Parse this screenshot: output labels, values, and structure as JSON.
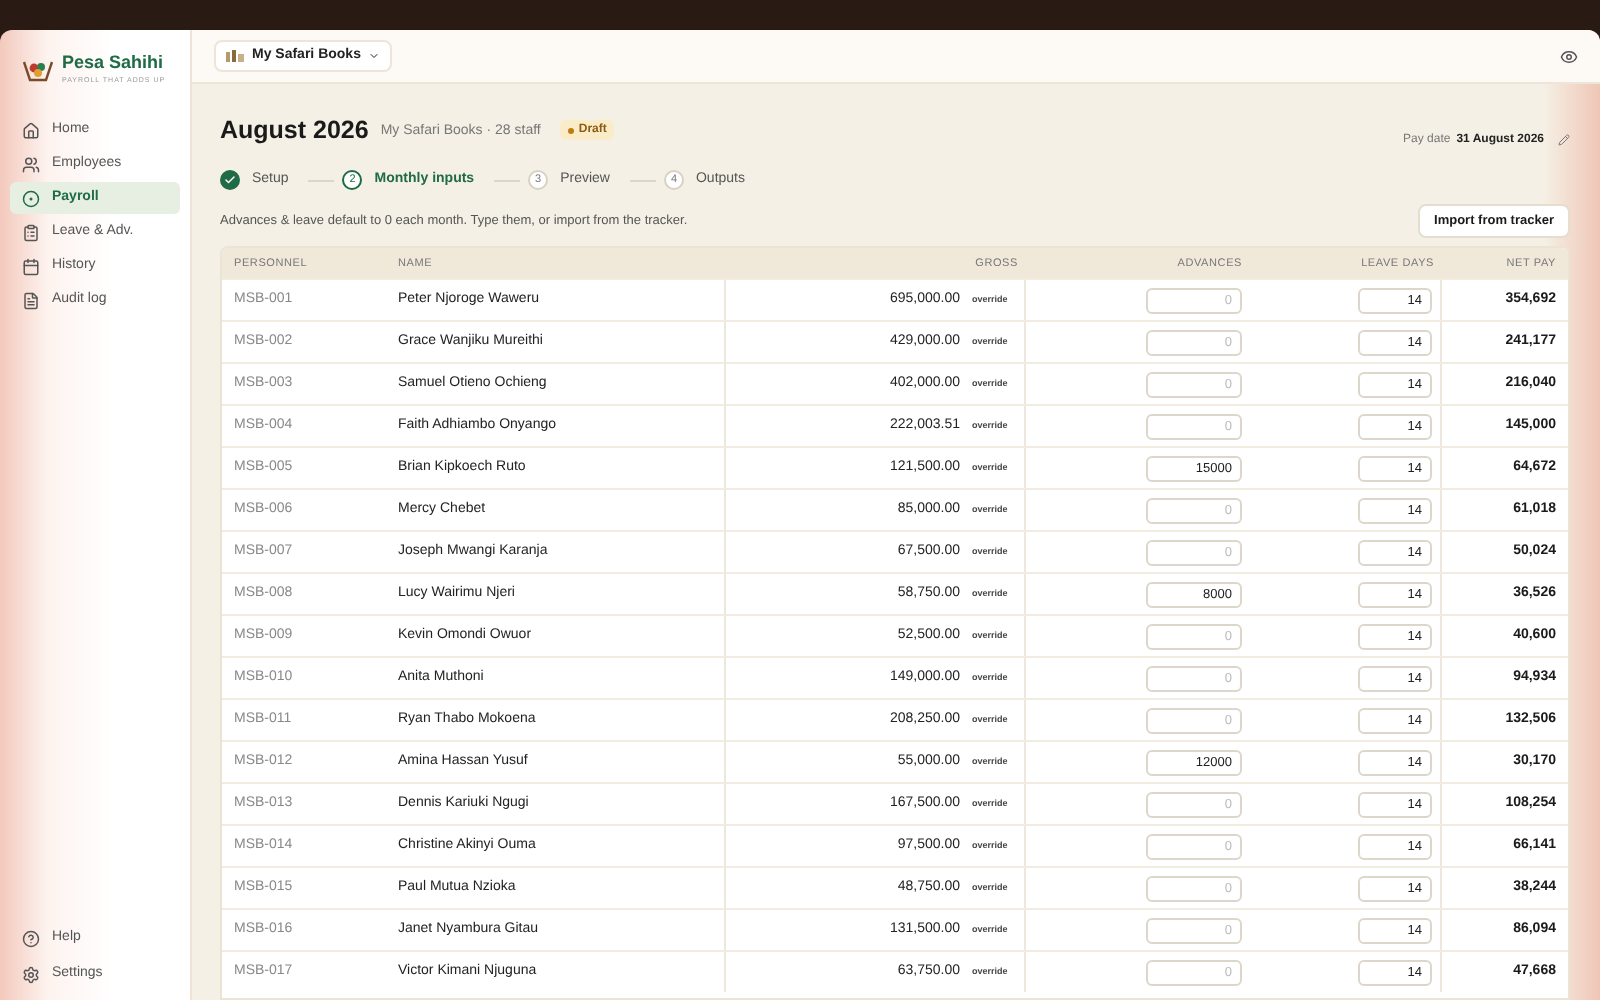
{
  "brand": {
    "name": "Pesa Sahihi",
    "tagline": "PAYROLL THAT ADDS UP"
  },
  "sidebar": {
    "items": [
      {
        "kind": "home",
        "label": "Home",
        "selected": false
      },
      {
        "kind": "employees",
        "label": "Employees",
        "selected": false
      },
      {
        "kind": "payroll",
        "label": "Payroll",
        "selected": true
      },
      {
        "kind": "leave",
        "label": "Leave & Adv.",
        "selected": false
      },
      {
        "kind": "history",
        "label": "History",
        "selected": false
      },
      {
        "kind": "audit",
        "label": "Audit log",
        "selected": false
      }
    ],
    "footer": [
      {
        "kind": "help",
        "label": "Help"
      },
      {
        "kind": "settings",
        "label": "Settings"
      }
    ]
  },
  "workspace": {
    "name": "My Safari Books"
  },
  "header": {
    "title": "August 2026",
    "subtitle": "My Safari Books · 28 staff",
    "status": "Draft",
    "pay_date_label": "Pay date",
    "pay_date": "31 August 2026"
  },
  "steps": [
    {
      "label": "Setup",
      "done": true,
      "selected": false
    },
    {
      "number": "2",
      "label": "Monthly inputs",
      "done": false,
      "selected": true
    },
    {
      "number": "3",
      "label": "Preview",
      "done": false,
      "selected": false
    },
    {
      "number": "4",
      "label": "Outputs",
      "done": false,
      "selected": false
    }
  ],
  "hint": "Advances & leave default to 0 each month. Type them, or import from the tracker.",
  "import_button": "Import from tracker",
  "table": {
    "columns": [
      "PERSONNEL",
      "NAME",
      "GROSS",
      "ADVANCES",
      "LEAVE DAYS",
      "NET PAY"
    ],
    "rows": [
      {
        "id": "MSB-001",
        "name": "Peter Njoroge Waweru",
        "gross": "695,000.00",
        "tag": "override",
        "advances": {
          "placeholder": "0"
        },
        "leave_days": "14",
        "net_pay": "354,692"
      },
      {
        "id": "MSB-002",
        "name": "Grace Wanjiku Mureithi",
        "gross": "429,000.00",
        "tag": "override",
        "advances": {
          "placeholder": "0"
        },
        "leave_days": "14",
        "net_pay": "241,177"
      },
      {
        "id": "MSB-003",
        "name": "Samuel Otieno Ochieng",
        "gross": "402,000.00",
        "tag": "override",
        "advances": {
          "placeholder": "0"
        },
        "leave_days": "14",
        "net_pay": "216,040"
      },
      {
        "id": "MSB-004",
        "name": "Faith Adhiambo Onyango",
        "gross": "222,003.51",
        "tag": "override",
        "advances": {
          "placeholder": "0"
        },
        "leave_days": "14",
        "net_pay": "145,000"
      },
      {
        "id": "MSB-005",
        "name": "Brian Kipkoech Ruto",
        "gross": "121,500.00",
        "tag": "override",
        "advances": {
          "value": "15000"
        },
        "leave_days": "14",
        "net_pay": "64,672"
      },
      {
        "id": "MSB-006",
        "name": "Mercy Chebet",
        "gross": "85,000.00",
        "tag": "override",
        "advances": {
          "placeholder": "0"
        },
        "leave_days": "14",
        "net_pay": "61,018"
      },
      {
        "id": "MSB-007",
        "name": "Joseph Mwangi Karanja",
        "gross": "67,500.00",
        "tag": "override",
        "advances": {
          "placeholder": "0"
        },
        "leave_days": "14",
        "net_pay": "50,024"
      },
      {
        "id": "MSB-008",
        "name": "Lucy Wairimu Njeri",
        "gross": "58,750.00",
        "tag": "override",
        "advances": {
          "value": "8000"
        },
        "leave_days": "14",
        "net_pay": "36,526"
      },
      {
        "id": "MSB-009",
        "name": "Kevin Omondi Owuor",
        "gross": "52,500.00",
        "tag": "override",
        "advances": {
          "placeholder": "0"
        },
        "leave_days": "14",
        "net_pay": "40,600"
      },
      {
        "id": "MSB-010",
        "name": "Anita Muthoni",
        "gross": "149,000.00",
        "tag": "override",
        "advances": {
          "placeholder": "0"
        },
        "leave_days": "14",
        "net_pay": "94,934"
      },
      {
        "id": "MSB-011",
        "name": "Ryan Thabo Mokoena",
        "gross": "208,250.00",
        "tag": "override",
        "advances": {
          "placeholder": "0"
        },
        "leave_days": "14",
        "net_pay": "132,506"
      },
      {
        "id": "MSB-012",
        "name": "Amina Hassan Yusuf",
        "gross": "55,000.00",
        "tag": "override",
        "advances": {
          "value": "12000"
        },
        "leave_days": "14",
        "net_pay": "30,170"
      },
      {
        "id": "MSB-013",
        "name": "Dennis Kariuki Ngugi",
        "gross": "167,500.00",
        "tag": "override",
        "advances": {
          "placeholder": "0"
        },
        "leave_days": "14",
        "net_pay": "108,254"
      },
      {
        "id": "MSB-014",
        "name": "Christine Akinyi Ouma",
        "gross": "97,500.00",
        "tag": "override",
        "advances": {
          "placeholder": "0"
        },
        "leave_days": "14",
        "net_pay": "66,141"
      },
      {
        "id": "MSB-015",
        "name": "Paul Mutua Nzioka",
        "gross": "48,750.00",
        "tag": "override",
        "advances": {
          "placeholder": "0"
        },
        "leave_days": "14",
        "net_pay": "38,244"
      },
      {
        "id": "MSB-016",
        "name": "Janet Nyambura Gitau",
        "gross": "131,500.00",
        "tag": "override",
        "advances": {
          "placeholder": "0"
        },
        "leave_days": "14",
        "net_pay": "86,094"
      },
      {
        "id": "MSB-017",
        "name": "Victor Kimani Njuguna",
        "gross": "63,750.00",
        "tag": "override",
        "advances": {
          "placeholder": "0"
        },
        "leave_days": "14",
        "net_pay": "47,668"
      }
    ]
  }
}
